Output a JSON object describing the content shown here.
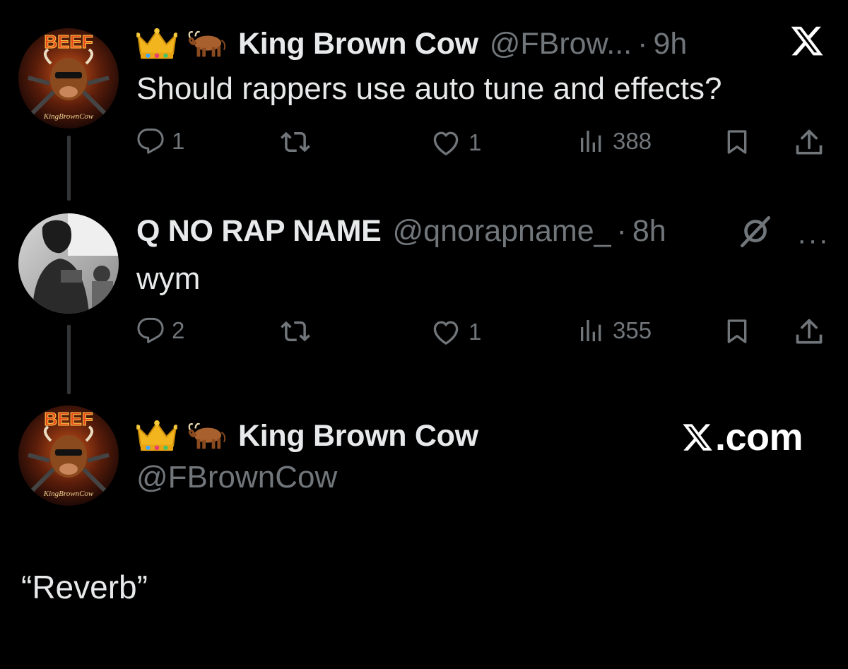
{
  "tweet1": {
    "display_name": "King Brown Cow",
    "handle": "@FBrow...",
    "separator": "·",
    "time": "9h",
    "text": "Should rappers use auto tune and effects?",
    "replies": "1",
    "reposts": "",
    "likes": "1",
    "views": "388",
    "avatar_text": "BEEF",
    "avatar_caption": "KingBrownCow",
    "badge_icons": [
      "crown-emoji",
      "ox-emoji"
    ]
  },
  "tweet2": {
    "display_name": "Q NO RAP NAME",
    "handle": "@qnorapname_",
    "separator": "·",
    "time": "8h",
    "text": "wym",
    "replies": "2",
    "reposts": "",
    "likes": "1",
    "views": "355",
    "more_label": "···"
  },
  "tweet3": {
    "display_name": "King Brown Cow",
    "handle": "@FBrownCow",
    "avatar_text": "BEEF",
    "avatar_caption": "KingBrownCow",
    "badge_icons": [
      "crown-emoji",
      "ox-emoji"
    ]
  },
  "brand": {
    "site_suffix": ".com"
  },
  "caption": {
    "text": "“Reverb”"
  },
  "colors": {
    "background": "#000000",
    "primary_text": "#e7e9ea",
    "secondary_text": "#71767b",
    "thread_line": "#333639"
  }
}
